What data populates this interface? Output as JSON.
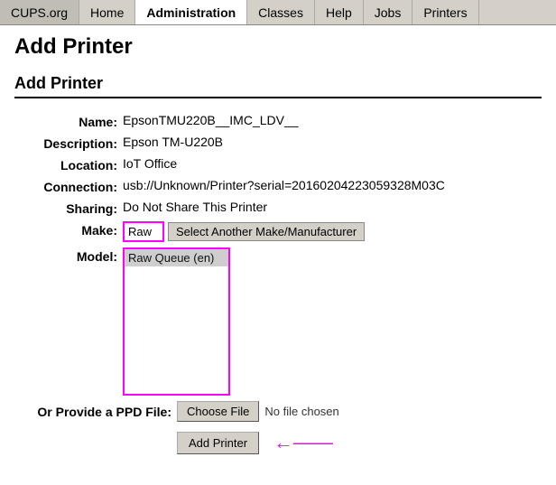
{
  "nav": {
    "brand": "CUPS.org",
    "items": [
      {
        "label": "Home",
        "active": false
      },
      {
        "label": "Administration",
        "active": true
      },
      {
        "label": "Classes",
        "active": false
      },
      {
        "label": "Help",
        "active": false
      },
      {
        "label": "Jobs",
        "active": false
      },
      {
        "label": "Printers",
        "active": false
      }
    ]
  },
  "page": {
    "title": "Add Printer",
    "section_title": "Add Printer"
  },
  "form": {
    "name_label": "Name:",
    "name_value": "EpsonTMU220B__IMC_LDV__",
    "description_label": "Description:",
    "description_value": "Epson TM-U220B",
    "location_label": "Location:",
    "location_value": "IoT Office",
    "connection_label": "Connection:",
    "connection_value": "usb://Unknown/Printer?serial=20160204223059328M03C",
    "sharing_label": "Sharing:",
    "sharing_value": "Do Not Share This Printer",
    "make_label": "Make:",
    "make_value": "Raw",
    "select_manufacturer_btn": "Select Another Make/Manufacturer",
    "model_label": "Model:",
    "model_option": "Raw Queue (en)",
    "ppd_label": "Or Provide a PPD File:",
    "choose_file_btn": "Choose File",
    "no_file_text": "No file chosen",
    "add_printer_btn": "Add Printer"
  }
}
